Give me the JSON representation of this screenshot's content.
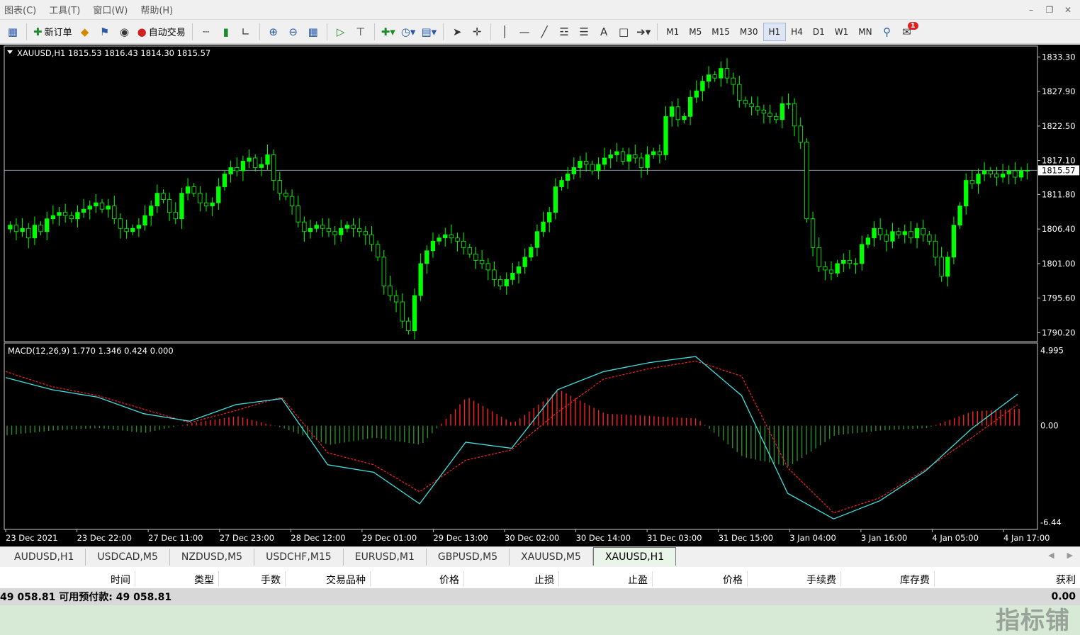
{
  "menu": [
    "图表(C)",
    "工具(T)",
    "窗口(W)",
    "帮助(H)"
  ],
  "toolbar": {
    "new_order_label": "新订单",
    "auto_trade_label": "自动交易",
    "timeframes": [
      "M1",
      "M5",
      "M15",
      "M30",
      "H1",
      "H4",
      "D1",
      "W1",
      "MN"
    ],
    "active_timeframe": "H1",
    "notification_count": "1"
  },
  "chart": {
    "info_line": "XAUUSD,H1  1815.53 1816.43 1814.30 1815.57",
    "current_price": "1815.57",
    "price_ticks": [
      "1833.30",
      "1827.90",
      "1822.50",
      "1817.10",
      "1811.80",
      "1806.40",
      "1801.00",
      "1795.60",
      "1790.20"
    ],
    "time_ticks": [
      "23 Dec 2021",
      "23 Dec 22:00",
      "27 Dec 11:00",
      "27 Dec 23:00",
      "28 Dec 12:00",
      "29 Dec 01:00",
      "29 Dec 13:00",
      "30 Dec 02:00",
      "30 Dec 14:00",
      "31 Dec 03:00",
      "31 Dec 15:00",
      "3 Jan 04:00",
      "3 Jan 16:00",
      "4 Jan 05:00",
      "4 Jan 17:00"
    ],
    "macd_label": "MACD(12,26,9) 1.770 1.346 0.424 0.000",
    "macd_ticks": [
      "4.995",
      "0.00",
      "-6.44"
    ],
    "colors": {
      "bull": "#00ff00",
      "bear": "#000000",
      "macd_line": "#40e0e0",
      "signal_line": "#ff2020",
      "hist_up": "#ff2020",
      "hist_down": "#2e8b2e"
    }
  },
  "chart_data": {
    "type": "candlestick",
    "symbol": "XAUUSD",
    "timeframe": "H1",
    "close_series": [
      1807,
      1806,
      1806.5,
      1805,
      1807,
      1806,
      1808,
      1808.5,
      1809,
      1808.5,
      1808,
      1809,
      1809.5,
      1810,
      1810.5,
      1809.5,
      1810,
      1808,
      1806.5,
      1806,
      1806.5,
      1807,
      1808.5,
      1810,
      1812,
      1811,
      1809,
      1808,
      1812,
      1813,
      1812,
      1810.5,
      1810,
      1810.5,
      1813,
      1815,
      1816,
      1815.5,
      1817,
      1817.5,
      1816,
      1816.5,
      1818,
      1814,
      1812,
      1811.5,
      1810,
      1807.5,
      1806,
      1806.5,
      1807,
      1806.5,
      1806,
      1805.5,
      1806.5,
      1807,
      1806.5,
      1806,
      1805.5,
      1804,
      1802,
      1797.5,
      1796,
      1795,
      1792,
      1790.5,
      1796,
      1801,
      1803,
      1804.5,
      1805,
      1805.5,
      1805,
      1804.5,
      1803.5,
      1802.5,
      1801.5,
      1801,
      1800,
      1798.5,
      1797.5,
      1798.5,
      1799.5,
      1800.5,
      1802,
      1803.5,
      1806,
      1807.5,
      1809,
      1813,
      1814,
      1815,
      1816,
      1817,
      1816.5,
      1815.5,
      1816.5,
      1817.5,
      1818,
      1818.5,
      1817,
      1818,
      1817.5,
      1816,
      1818,
      1818.5,
      1818,
      1824,
      1825.5,
      1823.5,
      1824,
      1827,
      1828,
      1829.5,
      1830.5,
      1830,
      1831.5,
      1830,
      1829,
      1826.5,
      1826,
      1825.5,
      1825,
      1824.5,
      1824,
      1823.5,
      1826,
      1826,
      1822.5,
      1820,
      1808,
      1803.5,
      1800.5,
      1800,
      1799.5,
      1801,
      1801.5,
      1801,
      1801,
      1804,
      1805,
      1806.5,
      1805.5,
      1804.5,
      1806,
      1805.5,
      1806,
      1805,
      1806.5,
      1805.5,
      1804.5,
      1802,
      1799,
      1802,
      1807,
      1810,
      1814,
      1813.5,
      1815,
      1815.5,
      1815,
      1814.5,
      1815,
      1815.5,
      1814.5,
      1815.5,
      1815.57
    ],
    "macd": [
      3.2,
      2.4,
      1.9,
      0.8,
      0.3,
      1.4,
      1.8,
      -2.6,
      -3.1,
      -5.2,
      -1.1,
      -1.5,
      2.4,
      3.6,
      4.2,
      4.6,
      2.0,
      -4.5,
      -6.2,
      -5.0,
      -3.0,
      -0.2,
      2.1
    ],
    "signal": [
      3.6,
      2.6,
      2.0,
      1.1,
      0.2,
      1.0,
      1.9,
      -1.8,
      -2.6,
      -4.4,
      -2.3,
      -1.6,
      0.9,
      3.1,
      3.8,
      4.3,
      3.3,
      -2.8,
      -5.8,
      -4.8,
      -2.9,
      -0.8,
      1.4
    ],
    "price_range": [
      1788.8,
      1835.0
    ],
    "macd_range": [
      -6.9,
      5.5
    ]
  },
  "tabs": [
    "AUDUSD,H1",
    "USDCAD,M5",
    "NZDUSD,M5",
    "USDCHF,M15",
    "EURUSD,M1",
    "GBPUSD,M5",
    "XAUUSD,M5",
    "XAUUSD,H1"
  ],
  "active_tab": "XAUUSD,H1",
  "terminal": {
    "columns": [
      "时间",
      "类型",
      "手数",
      "交易品种",
      "价格",
      "止损",
      "止盈",
      "价格",
      "手续费",
      "库存费",
      "获利"
    ],
    "balance_text": "49 058.81  可用预付款: 49 058.81",
    "profit": "0.00"
  },
  "watermark": "指标铺"
}
